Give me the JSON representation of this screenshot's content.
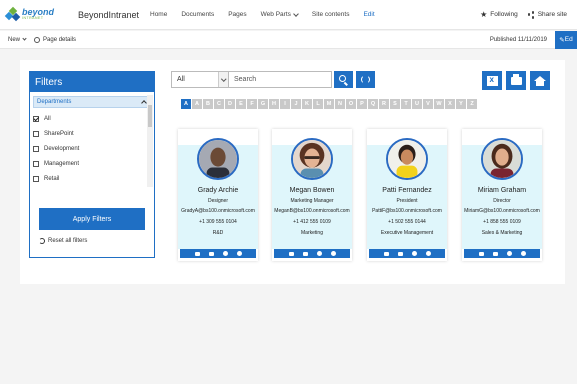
{
  "header": {
    "logo_main": "beyond",
    "logo_sub": "INTRANET",
    "site_name": "BeyondIntranet",
    "nav": [
      "Home",
      "Documents",
      "Pages",
      "Web Parts",
      "Site contents",
      "Edit"
    ],
    "following": "Following",
    "share": "Share site"
  },
  "cmdbar": {
    "new": "New",
    "page_details": "Page details",
    "published": "Published 11/11/2019",
    "edit": "Ed"
  },
  "filters": {
    "title": "Filters",
    "section": "Departments",
    "items": [
      {
        "label": "All",
        "checked": true
      },
      {
        "label": "SharePoint",
        "checked": false
      },
      {
        "label": "Development",
        "checked": false
      },
      {
        "label": "Management",
        "checked": false
      },
      {
        "label": "Retail",
        "checked": false
      }
    ],
    "apply": "Apply Filters",
    "reset": "Reset all filters"
  },
  "search": {
    "dropdown_value": "All",
    "placeholder": "Search"
  },
  "alphabet": [
    "A",
    "A",
    "B",
    "C",
    "D",
    "E",
    "F",
    "G",
    "H",
    "I",
    "J",
    "K",
    "L",
    "M",
    "N",
    "O",
    "P",
    "Q",
    "R",
    "S",
    "T",
    "U",
    "V",
    "W",
    "X",
    "Y",
    "Z"
  ],
  "people": [
    {
      "name": "Grady Archie",
      "title": "Designer",
      "email": "GradyA@bs100.onmicrosoft.com",
      "phone": "+1 309 555 0104",
      "dept": "R&D"
    },
    {
      "name": "Megan Bowen",
      "title": "Marketing Manager",
      "email": "MeganB@bs100.onmicrosoft.com",
      "phone": "+1 412 555 0109",
      "dept": "Marketing"
    },
    {
      "name": "Patti Fernandez",
      "title": "President",
      "email": "PattiF@bs100.onmicrosoft.com",
      "phone": "+1 502 555 0144",
      "dept": "Executive Management"
    },
    {
      "name": "Miriam Graham",
      "title": "Director",
      "email": "MiriamG@bs100.onmicrosoft.com",
      "phone": "+1 858 555 0109",
      "dept": "Sales & Marketing"
    }
  ],
  "colors": {
    "accent": "#1f6fc4",
    "card_band": "#dff6fb",
    "alpha_inactive": "#c9c9c9"
  }
}
